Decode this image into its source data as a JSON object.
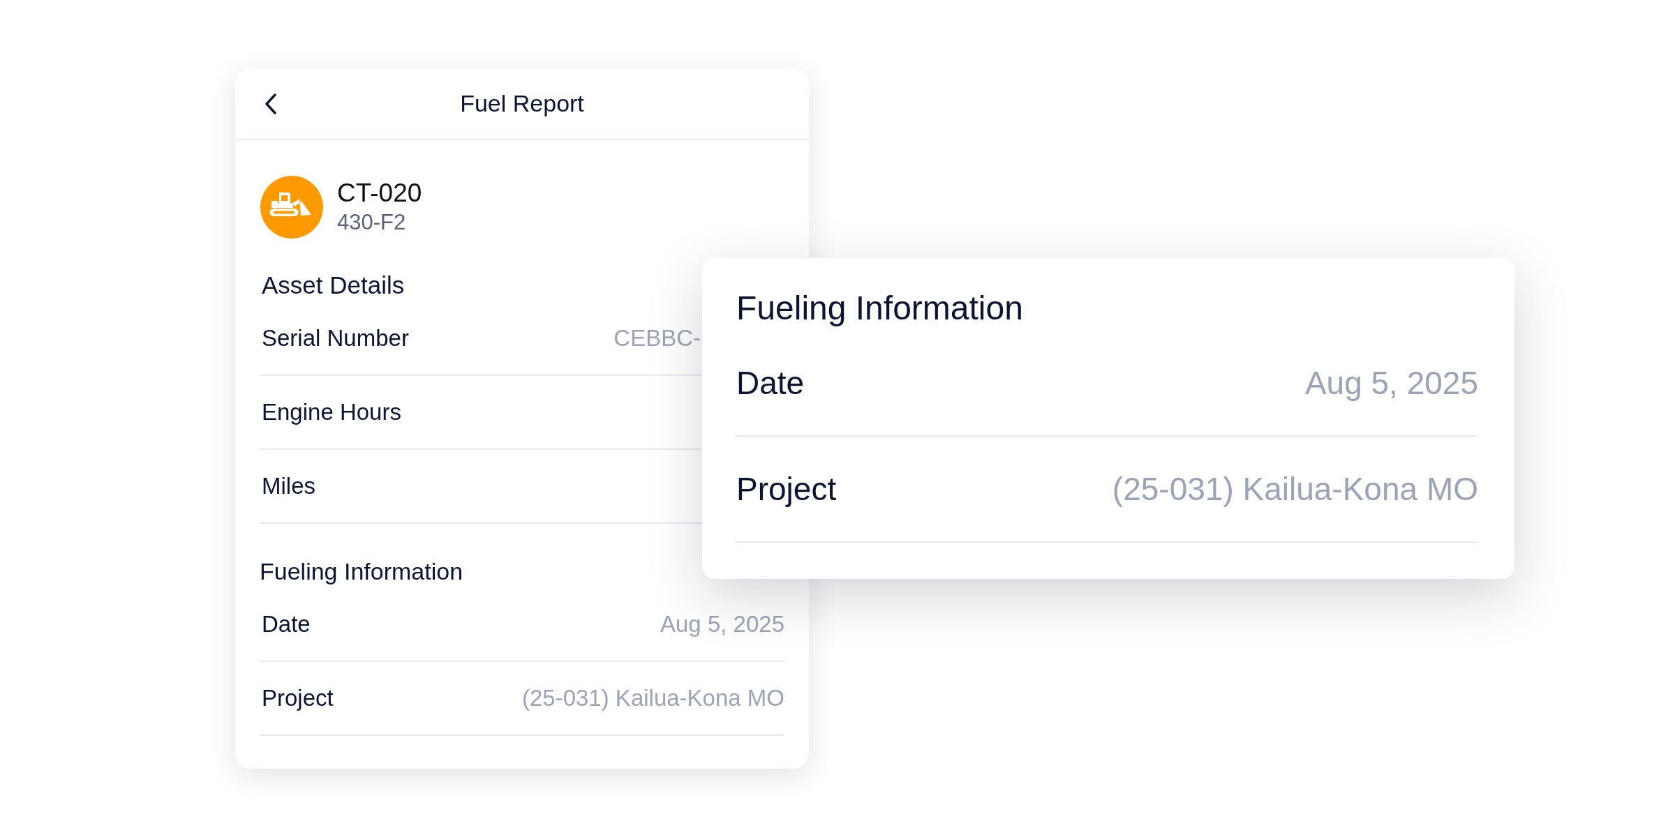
{
  "screen": {
    "title": "Fuel Report"
  },
  "asset": {
    "name": "CT-020",
    "code": "430-F2"
  },
  "asset_details": {
    "title": "Asset Details",
    "rows": [
      {
        "label": "Serial Number",
        "value": "CEBBC-"
      },
      {
        "label": "Engine Hours"
      },
      {
        "label": "Miles"
      }
    ]
  },
  "fueling_information": {
    "title": "Fueling Information",
    "rows": [
      {
        "label": "Date",
        "value": "Aug 5, 2025"
      },
      {
        "label": "Project",
        "value": "(25-031) Kailua-Kona MO"
      }
    ]
  },
  "fueling_popout": {
    "title": "Fueling Information",
    "rows": [
      {
        "label": "Date",
        "value": "Aug 5, 2025"
      },
      {
        "label": "Project",
        "value": "(25-031) Kailua-Kona MO"
      }
    ]
  }
}
